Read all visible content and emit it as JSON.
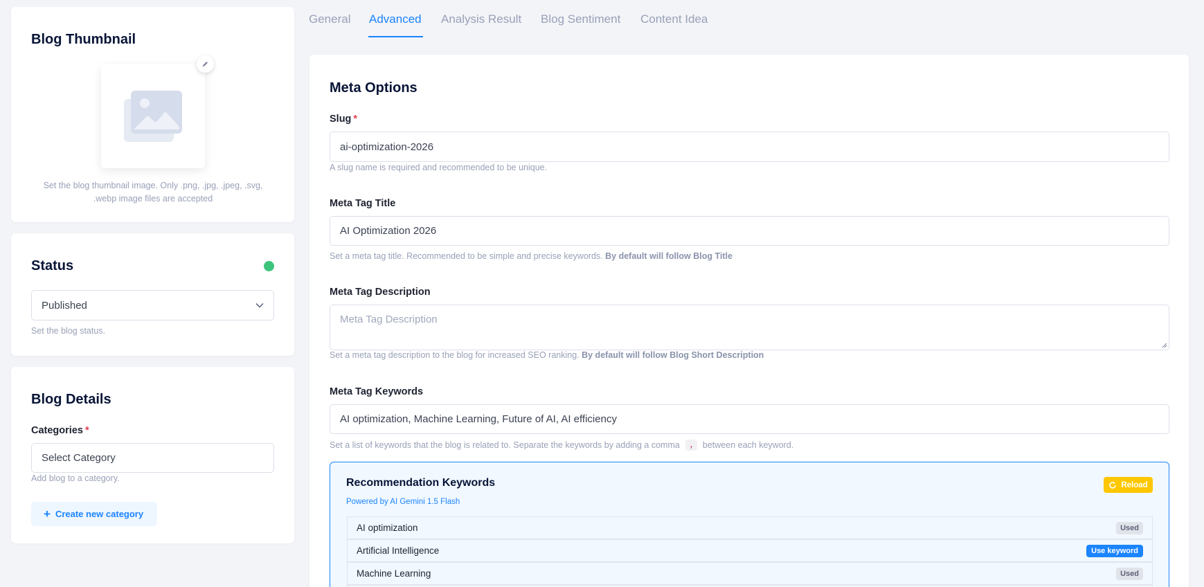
{
  "tabs": [
    {
      "label": "General"
    },
    {
      "label": "Advanced"
    },
    {
      "label": "Analysis Result"
    },
    {
      "label": "Blog Sentiment"
    },
    {
      "label": "Content Idea"
    }
  ],
  "active_tab": "Advanced",
  "thumbnail": {
    "title": "Blog Thumbnail",
    "help": "Set the blog thumbnail image. Only .png, .jpg, .jpeg, .svg, .webp image files are accepted"
  },
  "status": {
    "title": "Status",
    "value": "Published",
    "help": "Set the blog status.",
    "indicator_color": "#3cc47c"
  },
  "details": {
    "title": "Blog Details",
    "categories_label": "Categories",
    "required_mark": "*",
    "categories_value": "Select Category",
    "categories_help": "Add blog to a category.",
    "create_button": "Create new category"
  },
  "meta": {
    "title": "Meta Options",
    "slug_label": "Slug",
    "slug_value": "ai-optimization-2026",
    "slug_help": "A slug name is required and recommended to be unique.",
    "tag_title_label": "Meta Tag Title",
    "tag_title_value": "AI Optimization 2026",
    "tag_title_help": "Set a meta tag title. Recommended to be simple and precise keywords.",
    "tag_title_help_bold": "By default will follow Blog Title",
    "desc_label": "Meta Tag Description",
    "desc_placeholder": "Meta Tag Description",
    "desc_help": "Set a meta tag description to the blog for increased SEO ranking.",
    "desc_help_bold": "By default will follow Blog Short Description",
    "keywords_label": "Meta Tag Keywords",
    "keywords_value": "AI optimization, Machine Learning, Future of AI, AI efficiency",
    "keywords_help_pre": "Set a list of keywords that the blog is related to. Separate the keywords by adding a comma",
    "keywords_help_code": ",",
    "keywords_help_post": "between each keyword."
  },
  "recommendation": {
    "title": "Recommendation Keywords",
    "powered_by": "Powered by AI Gemini 1.5 Flash",
    "reload_label": "Reload",
    "reload_color": "#ffc700",
    "items": [
      {
        "keyword": "AI optimization",
        "action": "Used"
      },
      {
        "keyword": "Artificial Intelligence",
        "action": "Use keyword"
      },
      {
        "keyword": "Machine Learning",
        "action": "Used"
      }
    ]
  },
  "colors": {
    "accent": "#1b84ff",
    "background": "#f3f4f8"
  }
}
